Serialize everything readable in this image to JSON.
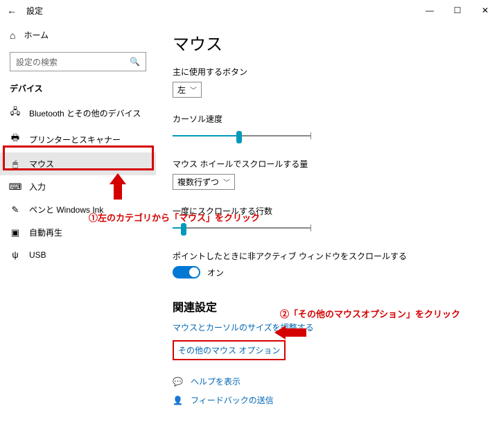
{
  "window": {
    "title": "設定"
  },
  "sidebar": {
    "home": "ホーム",
    "search_placeholder": "設定の検索",
    "group": "デバイス",
    "items": [
      {
        "label": "Bluetooth とその他のデバイス"
      },
      {
        "label": "プリンターとスキャナー"
      },
      {
        "label": "マウス"
      },
      {
        "label": "入力"
      },
      {
        "label": "ペンと Windows Ink"
      },
      {
        "label": "自動再生"
      },
      {
        "label": "USB"
      }
    ]
  },
  "main": {
    "heading": "マウス",
    "primary_button_label": "主に使用するボタン",
    "primary_button_value": "左",
    "cursor_speed_label": "カーソル速度",
    "cursor_speed_value": 48,
    "wheel_label": "マウス ホイールでスクロールする量",
    "wheel_value": "複数行ずつ",
    "lines_label": "一度にスクロールする行数",
    "lines_value": 8,
    "inactive_scroll_label": "ポイントしたときに非アクティブ ウィンドウをスクロールする",
    "inactive_scroll_state": "オン",
    "related_title": "関連設定",
    "link_cursor_size": "マウスとカーソルのサイズを調整する",
    "link_other_options": "その他のマウス オプション",
    "help": "ヘルプを表示",
    "feedback": "フィードバックの送信"
  },
  "annotations": {
    "a1": "①左のカテゴリから「マウス」をクリック",
    "a2": "②「その他のマウスオプション」をクリック"
  }
}
